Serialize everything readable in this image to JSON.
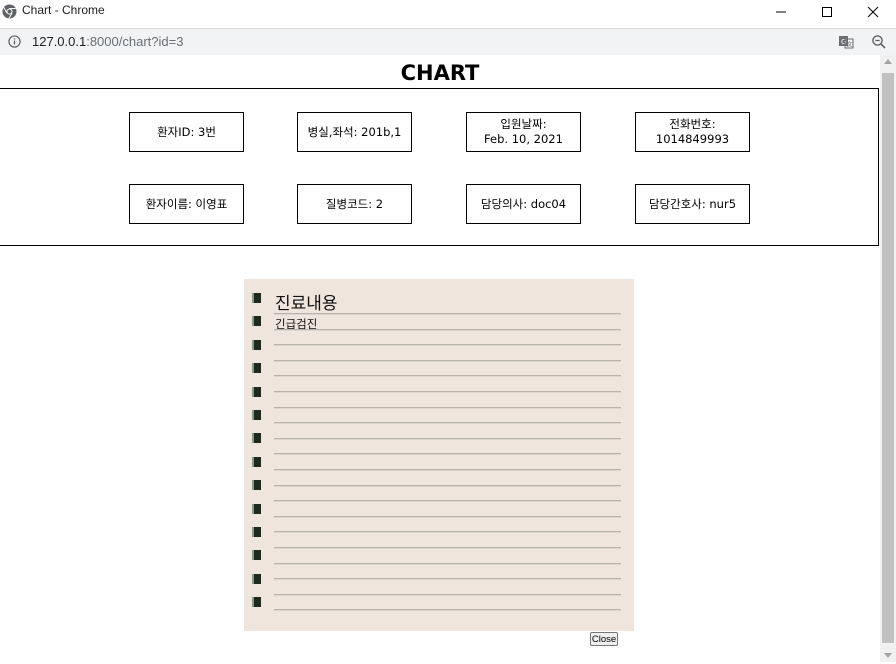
{
  "window": {
    "title": "Chart - Chrome"
  },
  "address": {
    "host": "127.0.0.1",
    "rest": ":8000/chart?id=3"
  },
  "page": {
    "title": "CHART"
  },
  "patient_info": {
    "row1": [
      {
        "label": "환자ID: 3번"
      },
      {
        "label": "병실,좌석: 201b,1"
      },
      {
        "label": "입원날짜:",
        "sub": "Feb. 10, 2021"
      },
      {
        "label": "전화번호:",
        "sub": "1014849993"
      }
    ],
    "row2": [
      {
        "label": "환자이름: 이영표"
      },
      {
        "label": "질병코드: 2"
      },
      {
        "label": "담당의사: doc04"
      },
      {
        "label": "담당간호사: nur5"
      }
    ]
  },
  "notebook": {
    "heading": "진료내용",
    "note": "긴급검진"
  },
  "close_button": "Close",
  "icons": {
    "logo": "chrome-logo-icon",
    "info": "info-icon",
    "translate": "translate-icon",
    "zoom": "zoom-icon"
  }
}
